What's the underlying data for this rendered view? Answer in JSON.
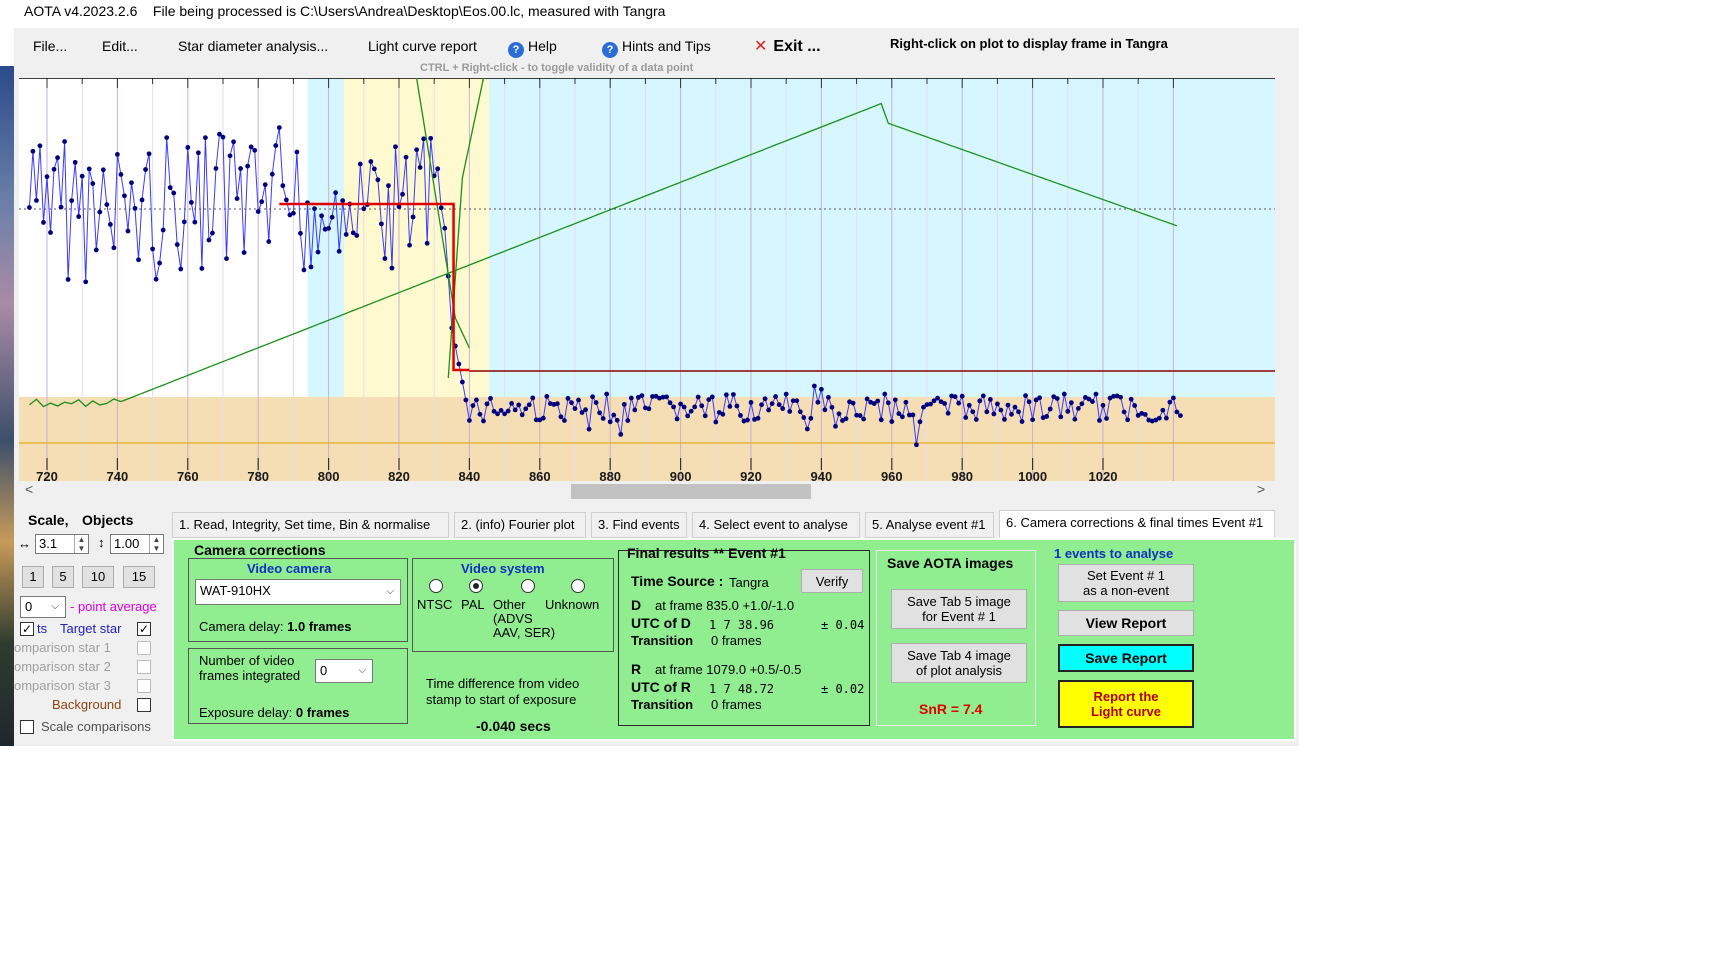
{
  "window": {
    "title": "AOTA v4.2023.2.6    File being processed is C:\\Users\\Andrea\\Desktop\\Eos.00.lc, measured with Tangra"
  },
  "menu": {
    "file": "File...",
    "edit": "Edit...",
    "star_diameter": "Star diameter analysis...",
    "light_curve_report": "Light curve report",
    "help": "Help",
    "hints": "Hints and Tips",
    "exit": "Exit ...",
    "right_click_hint": "Right-click on plot to display frame in Tangra",
    "ctrl_hint": "CTRL + Right-click  -  to toggle validity of a data point"
  },
  "colors": {
    "light_curve": "#3a3aff",
    "points": "#000080",
    "fit": "#e00000",
    "expected": "#1a8f1a",
    "baseline_band": "#f5deb3",
    "event_region": "#fff9cf",
    "search_region": "#d6f7ff",
    "panel_green": "#90ee90",
    "save_report_btn": "#00ffff",
    "report_curve_btn": "#ffff00",
    "snr": "#e00000"
  },
  "plot": {
    "x_ticks": [
      "720",
      "740",
      "760",
      "780",
      "800",
      "820",
      "840",
      "860",
      "880",
      "900",
      "920",
      "940",
      "960",
      "980",
      "1000",
      "1020"
    ]
  },
  "left_panel": {
    "scale_label": "Scale,",
    "objects_label": "Objects",
    "h_scale": "3.1",
    "v_scale": "1.00",
    "zoom_buttons": [
      "1",
      "5",
      "10",
      "15"
    ],
    "point_avg_value": "0",
    "point_avg_label": "- point average",
    "pts_label": "ts",
    "target_star": "Target star",
    "comp1": "omparison star 1",
    "comp2": "omparison star 2",
    "comp3": "omparison star 3",
    "background": "Background",
    "scale_comparisons": "Scale comparisons"
  },
  "tabs": [
    "1.  Read, Integrity, Set time, Bin & normalise",
    "2.  (info)  Fourier plot",
    "3. Find events",
    "4. Select event to analyse",
    "5. Analyse event #1",
    "6. Camera corrections & final times Event #1"
  ],
  "camera": {
    "title": "Camera corrections",
    "video_camera_title": "Video camera",
    "camera_model": "WAT-910HX",
    "camera_delay_label": "Camera delay:",
    "camera_delay_value": "1.0 frames",
    "video_system_title": "Video system",
    "ntsc": "NTSC",
    "pal": "PAL",
    "other": "Other",
    "other_sub1": "(ADVS",
    "other_sub2": "AAV, SER)",
    "unknown": "Unknown",
    "frames_int_label1": "Number of video",
    "frames_int_label2": "frames integrated",
    "frames_int_value": "0",
    "exposure_delay_label": "Exposure delay:",
    "exposure_delay_value": "0 frames",
    "time_diff_label1": "Time difference from video",
    "time_diff_label2": "stamp to start of exposure",
    "time_diff_value": "-0.040 secs"
  },
  "final": {
    "title": "Final results  **  Event #1",
    "time_source_label": "Time Source :",
    "time_source_value": "Tangra",
    "verify": "Verify",
    "d_label": "D",
    "d_frame": "at frame 835.0  +1.0/-1.0",
    "utc_d_label": "UTC of D",
    "utc_d_value": "1  7 38.96",
    "utc_d_err": "± 0.04",
    "transition_label": "Transition",
    "transition_d": "0 frames",
    "r_label": "R",
    "r_frame": "at frame 1079.0  +0.5/-0.5",
    "utc_r_label": "UTC of R",
    "utc_r_value": "1  7 48.72",
    "utc_r_err": "± 0.02",
    "transition_r": "0 frames"
  },
  "save_images": {
    "title": "Save AOTA images",
    "tab5_line1": "Save Tab 5 image",
    "tab5_line2": "for Event # 1",
    "tab4_line1": "Save Tab 4 image",
    "tab4_line2": "of plot analysis",
    "snr": "SnR = 7.4"
  },
  "report": {
    "events_title": "1  events to analyse",
    "set_event_line1": "Set Event # 1",
    "set_event_line2": "as a non-event",
    "view_report": "View Report",
    "save_report": "Save Report",
    "report_curve_line1": "Report the",
    "report_curve_line2": "Light curve"
  }
}
